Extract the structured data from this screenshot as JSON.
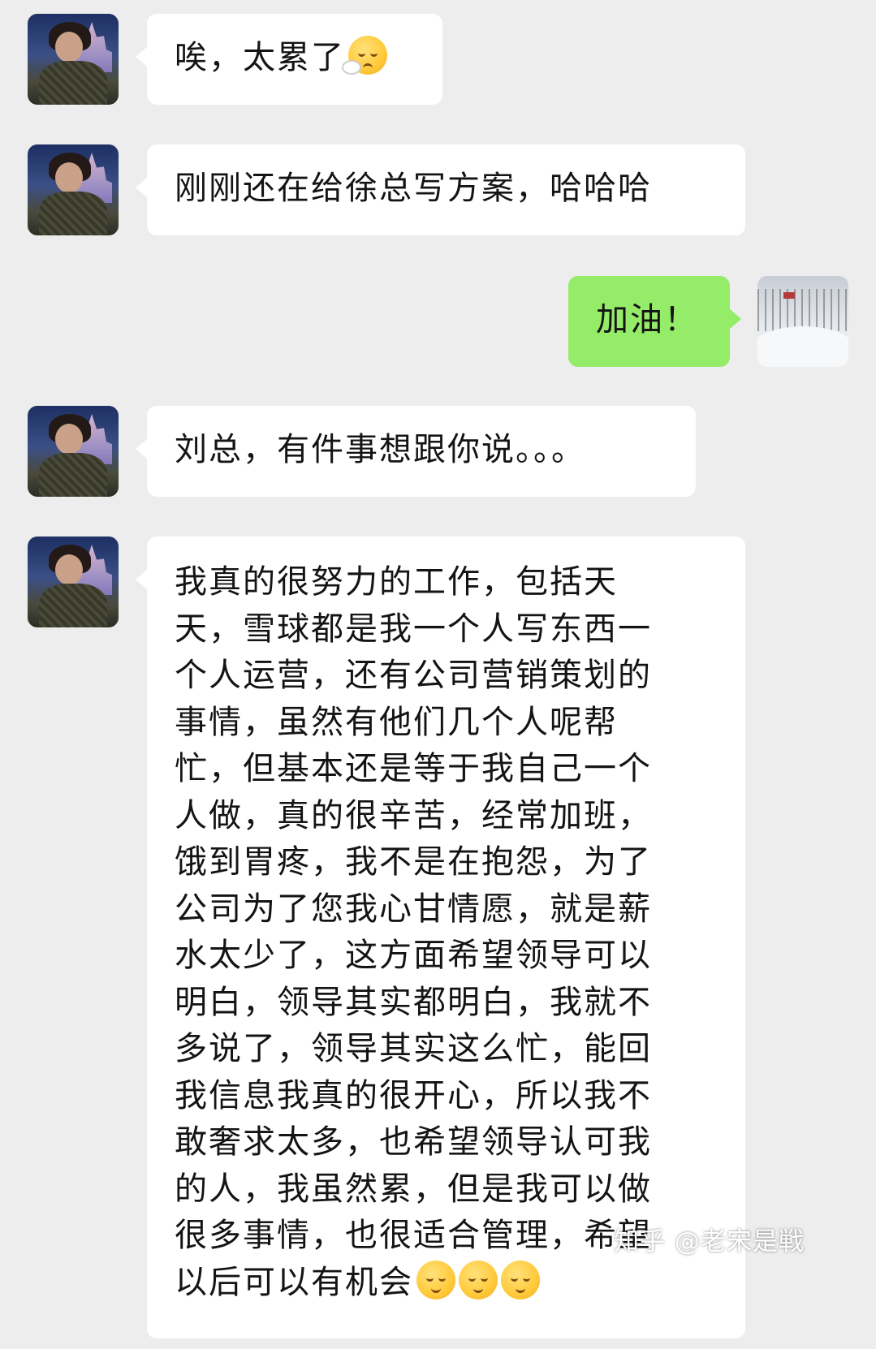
{
  "conversation": {
    "messages": [
      {
        "sender": "contact",
        "text": "唉，太累了",
        "emoji": "tired-face-emoji"
      },
      {
        "sender": "contact",
        "text": "刚刚还在给徐总写方案，哈哈哈"
      },
      {
        "sender": "me",
        "text": "加油！"
      },
      {
        "sender": "contact",
        "text": "刘总，有件事想跟你说。。。"
      },
      {
        "sender": "contact",
        "text": "我真的很努力的工作，包括天\n天，雪球都是我一个人写东西一\n个人运营，还有公司营销策划的\n事情，虽然有他们几个人呢帮\n忙，但基本还是等于我自己一个\n人做，真的很辛苦，经常加班，\n饿到胃疼，我不是在抱怨，为了\n公司为了您我心甘情愿，就是薪\n水太少了，这方面希望领导可以\n明白，领导其实都明白，我就不\n多说了，领导其实这么忙，能回\n我信息我真的很开心，所以我不\n敢奢求太多，也希望领导认可我\n的人，我虽然累，但是我可以做\n很多事情，也很适合管理，希望\n以后可以有机会",
        "emoji": "smiling-face-emoji",
        "emoji_count": 3
      }
    ]
  },
  "watermark": {
    "text": "知乎 @老宋是戦"
  },
  "colors": {
    "background": "#ededed",
    "incoming_bubble": "#ffffff",
    "outgoing_bubble": "#95ec69"
  }
}
